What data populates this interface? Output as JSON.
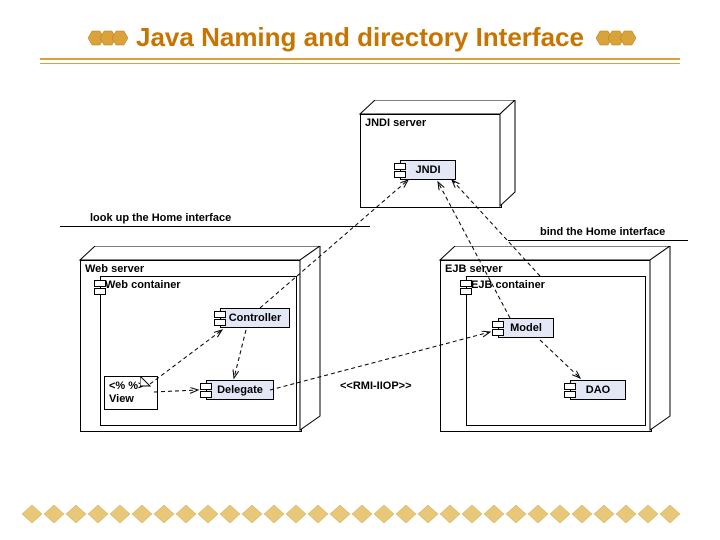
{
  "title": "Java Naming and directory Interface",
  "labels": {
    "lookup": "look up the Home interface",
    "bind": "bind the Home interface",
    "rmi": "<<RMI-IIOP>>"
  },
  "nodes": {
    "jndi_server": "JNDI server",
    "jndi": "JNDI",
    "web_server": "Web server",
    "web_container": "Web container",
    "controller": "Controller",
    "view_top": "<% %>",
    "view": "View",
    "delegate": "Delegate",
    "ejb_server": "EJB server",
    "ejb_container": "EJB container",
    "model": "Model",
    "dao": "DAO"
  }
}
